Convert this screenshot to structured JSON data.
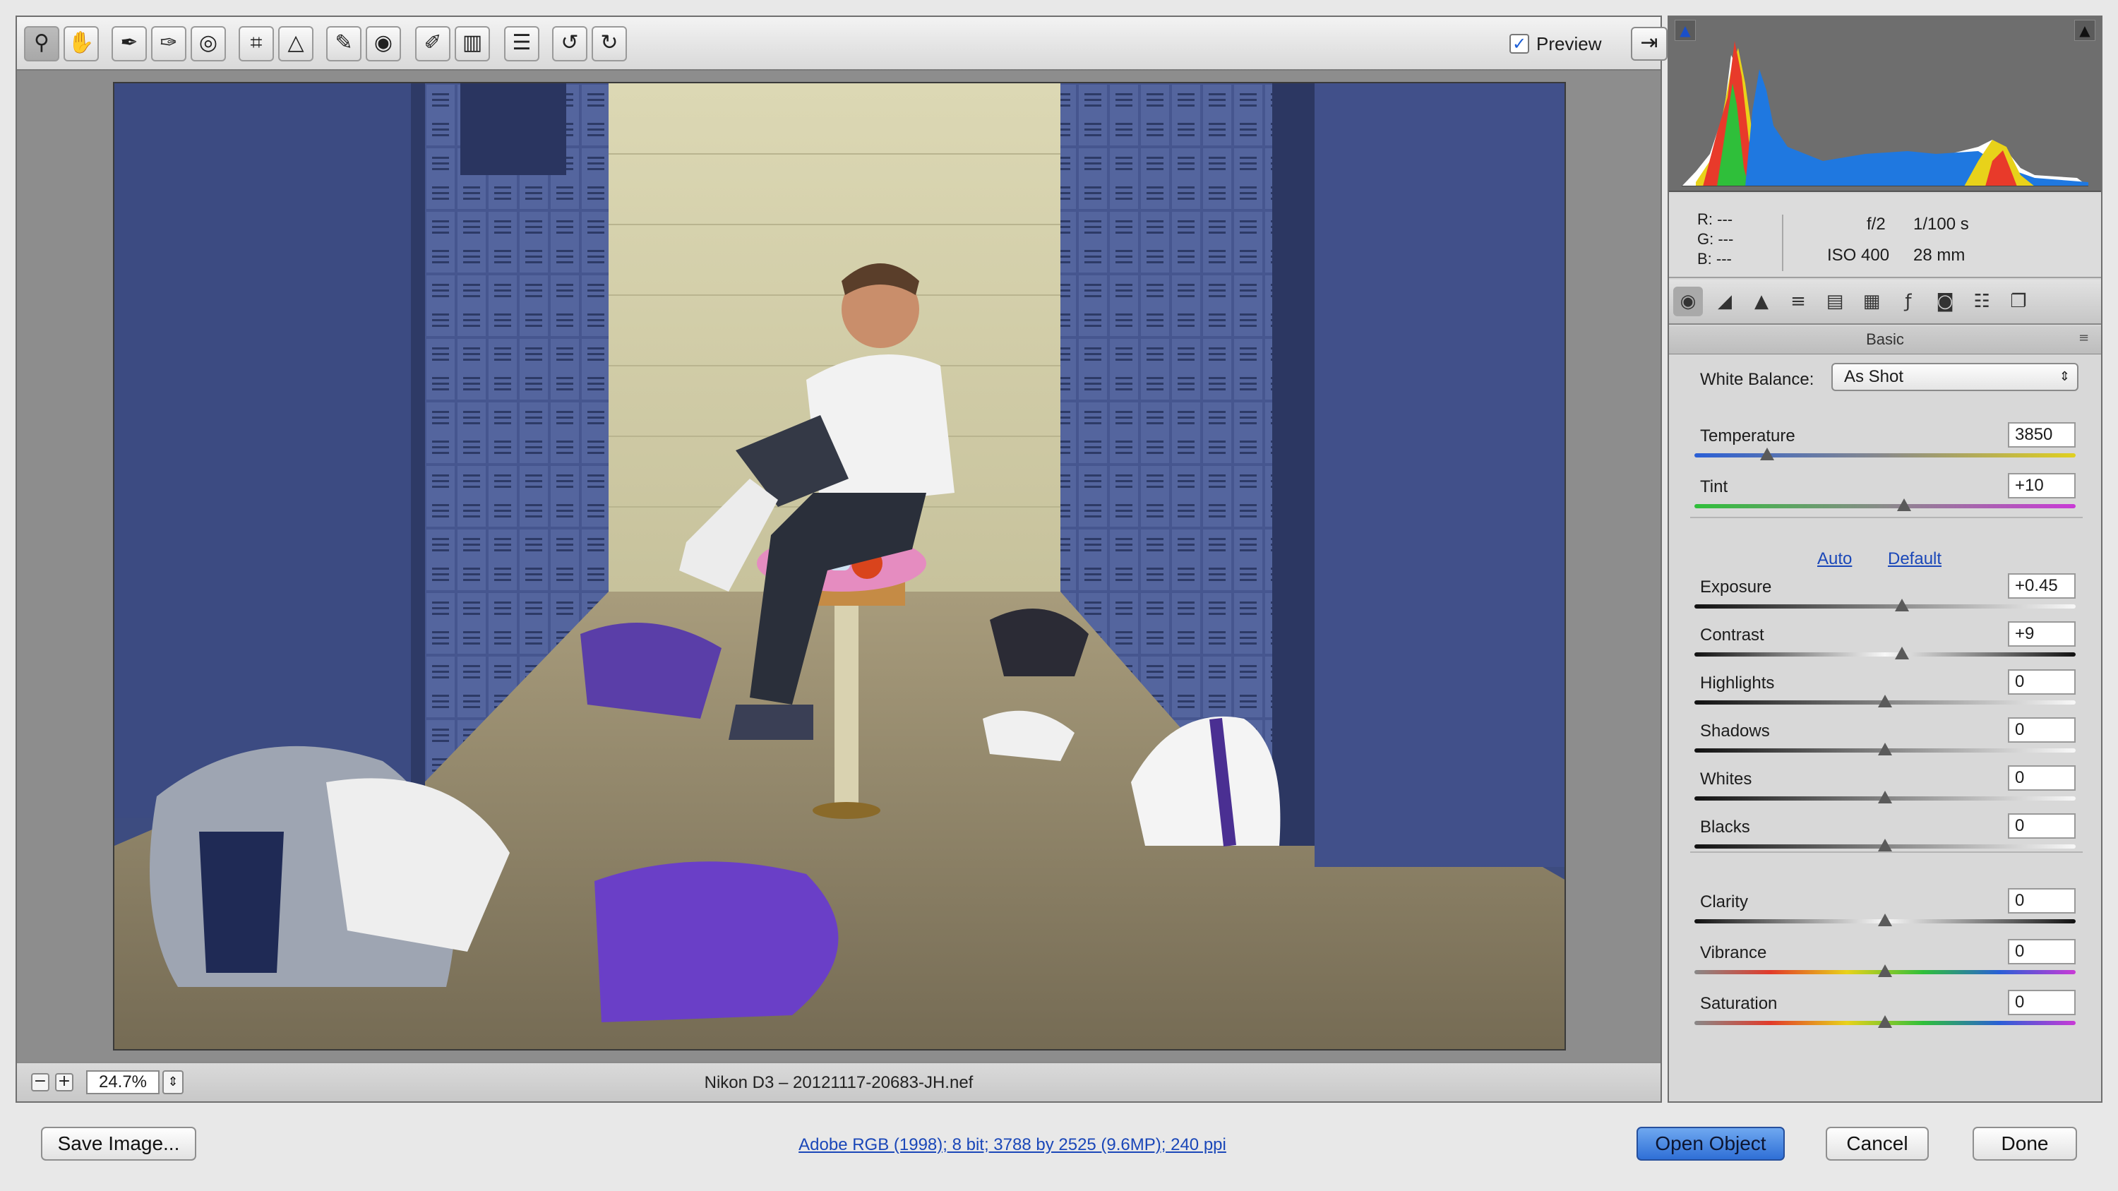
{
  "toolbar": {
    "tools": [
      {
        "name": "zoom-tool",
        "glyph": "🔍"
      },
      {
        "name": "hand-tool",
        "glyph": "✋"
      },
      {
        "name": "white-balance-tool",
        "glyph": "✒"
      },
      {
        "name": "color-sampler-tool",
        "glyph": "✒"
      },
      {
        "name": "targeted-adjustment-tool",
        "glyph": "◎"
      },
      {
        "name": "crop-tool",
        "glyph": "⌗"
      },
      {
        "name": "straighten-tool",
        "glyph": "△"
      },
      {
        "name": "spot-removal-tool",
        "glyph": "✎"
      },
      {
        "name": "red-eye-tool",
        "glyph": "◉"
      },
      {
        "name": "adjustment-brush-tool",
        "glyph": "🖌"
      },
      {
        "name": "graduated-filter-tool",
        "glyph": "▥"
      },
      {
        "name": "preferences-tool",
        "glyph": "☰"
      },
      {
        "name": "rotate-left-tool",
        "glyph": "↺"
      },
      {
        "name": "rotate-right-tool",
        "glyph": "↻"
      }
    ],
    "preview_label": "Preview",
    "preview_checked": true
  },
  "status": {
    "zoom": "24.7%",
    "filename": "Nikon D3  –  20121117-20683-JH.nef"
  },
  "info": {
    "r": "R:  ---",
    "g": "G:  ---",
    "b": "B:  ---",
    "aperture": "f/2",
    "shutter": "1/100 s",
    "iso": "ISO 400",
    "focal": "28 mm"
  },
  "panel": {
    "title": "Basic",
    "white_balance_label": "White Balance:",
    "white_balance_value": "As Shot",
    "auto_link": "Auto",
    "default_link": "Default",
    "wb_sliders": [
      {
        "label": "Temperature",
        "value": "3850",
        "position": 0.19
      },
      {
        "label": "Tint",
        "value": "+10",
        "position": 0.55
      }
    ],
    "tone_sliders": [
      {
        "label": "Exposure",
        "value": "+0.45",
        "position": 0.545
      },
      {
        "label": "Contrast",
        "value": "+9",
        "position": 0.545
      },
      {
        "label": "Highlights",
        "value": "0",
        "position": 0.5
      },
      {
        "label": "Shadows",
        "value": "0",
        "position": 0.5
      },
      {
        "label": "Whites",
        "value": "0",
        "position": 0.5
      },
      {
        "label": "Blacks",
        "value": "0",
        "position": 0.5
      }
    ],
    "presence_sliders": [
      {
        "label": "Clarity",
        "value": "0",
        "position": 0.5
      },
      {
        "label": "Vibrance",
        "value": "0",
        "position": 0.5
      },
      {
        "label": "Saturation",
        "value": "0",
        "position": 0.5
      }
    ]
  },
  "bottom": {
    "save_label": "Save Image...",
    "workflow_text": "Adobe RGB (1998); 8 bit; 3788 by 2525 (9.6MP); 240 ppi",
    "open_label": "Open Object",
    "cancel_label": "Cancel",
    "done_label": "Done"
  },
  "colors": {
    "accent": "#2f6fd6",
    "link": "#1a47b8",
    "locker_blue": "#3f4f82"
  }
}
